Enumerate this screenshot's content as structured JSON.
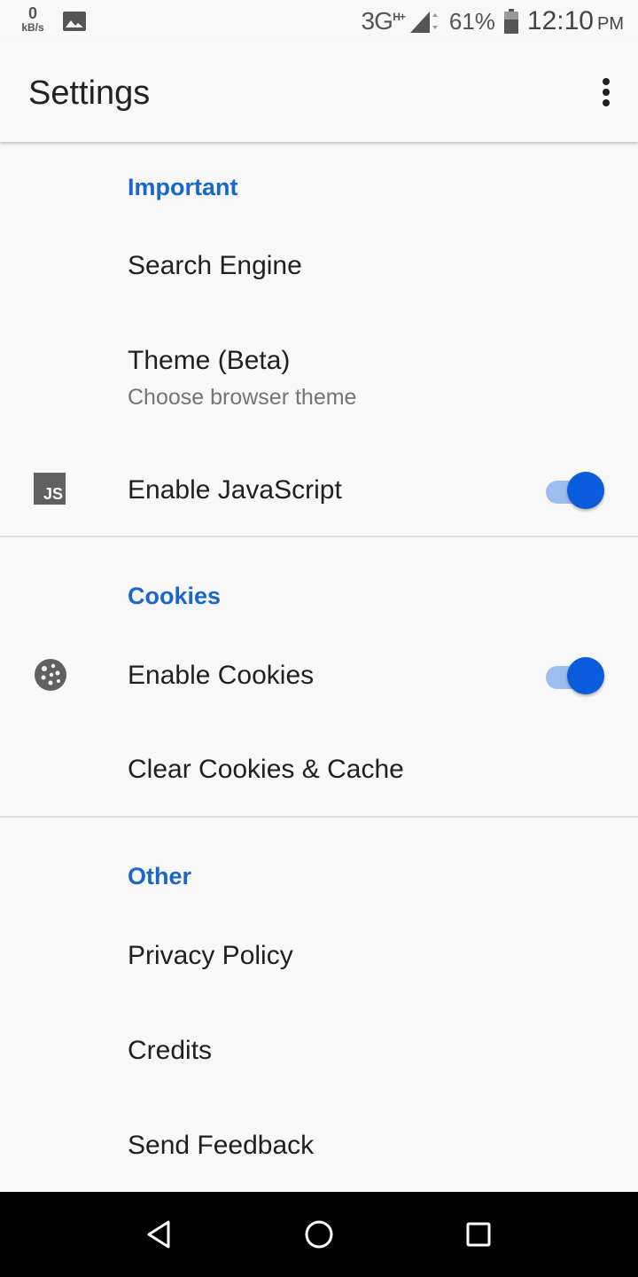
{
  "status_bar": {
    "speed_value": "0",
    "speed_unit": "kB/s",
    "network": "3G",
    "network_sup": "H+",
    "battery_percent": "61%",
    "time": "12:10",
    "ampm": "PM",
    "icons": [
      "image-icon",
      "signal-icon",
      "battery-icon"
    ]
  },
  "appbar": {
    "title": "Settings",
    "overflow_icon": "more-vert-icon"
  },
  "sections": {
    "important": {
      "header": "Important",
      "search_engine": "Search Engine",
      "theme_title": "Theme (Beta)",
      "theme_subtitle": "Choose browser theme",
      "javascript": {
        "label": "Enable JavaScript",
        "icon": "javascript-icon",
        "icon_text": "JS",
        "enabled": true
      }
    },
    "cookies": {
      "header": "Cookies",
      "enable": {
        "label": "Enable Cookies",
        "icon": "cookie-icon",
        "enabled": true
      },
      "clear": "Clear Cookies & Cache"
    },
    "other": {
      "header": "Other",
      "privacy": "Privacy Policy",
      "credits": "Credits",
      "feedback": "Send Feedback"
    }
  },
  "colors": {
    "accent": "#1a66cc",
    "switch_thumb": "#0b5cdc",
    "switch_track": "#9dbdf0",
    "background": "#f8f8f8"
  },
  "navbar": {
    "icons": [
      "back-icon",
      "home-icon",
      "recents-icon"
    ]
  }
}
